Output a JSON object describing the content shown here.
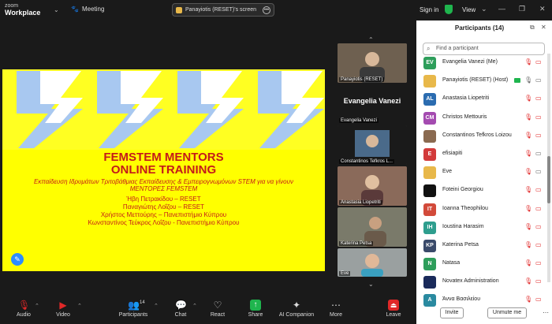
{
  "app": {
    "logo_small": "zoom",
    "logo_big": "Workplace",
    "meeting_label": "Meeting",
    "screen_share_label": "Panayiotis (RESET)'s screen",
    "signin": "Sign in",
    "view": "View"
  },
  "slide": {
    "title_line1": "FEMSTEM MENTORS",
    "title_line2": "ONLINE TRAINING",
    "subtitle": "Εκπαίδευση Ιδρυμάτων Τριτοβάθμιας Εκπαίδευσης & Εμπειρογνωμόνων STEM για να γίνουν ΜΕΝΤΟΡΕΣ FEMSTEM",
    "names": [
      "Ήβη Πετρακίδου – RESET",
      "Παναγιώτης Λοΐζου – RESET",
      "Χρήστος Μεττούρης – Πανεπιστήμιο Κύπρου",
      "Κωνσταντίνος Τεύκρος Λοΐζου - Πανεπιστήμιο Κύπρου"
    ],
    "colors": {
      "background": "#ffff00",
      "text": "#c41a1a",
      "chevron_light": "#a8c8f0",
      "chevron_white": "#ffffff"
    }
  },
  "strip": {
    "tiles": [
      {
        "label": "Panayiotis (RESET)"
      },
      {
        "name_big": "Evangelia Vanezi",
        "label": "Evangelia Vanezi"
      },
      {
        "label": "Constantinos Tefkros L..."
      },
      {
        "label": "Anastasia Liopetriti"
      },
      {
        "label": "Katerina Petsa"
      },
      {
        "label": "Eve"
      }
    ]
  },
  "toolbar": {
    "audio": "Audio",
    "video": "Video",
    "participants": "Participants",
    "participants_count": "14",
    "chat": "Chat",
    "react": "React",
    "share": "Share",
    "ai": "AI Companion",
    "more": "More",
    "leave": "Leave"
  },
  "panel": {
    "title": "Participants (14)",
    "search_placeholder": "Find a participant",
    "invite": "Invite",
    "unmute_me": "Unmute me",
    "participants": [
      {
        "initials": "EV",
        "color": "#2e9e5b",
        "name": "Evangelia Vanezi (Me)"
      },
      {
        "initials": "",
        "color": "#e8b84a",
        "name": "Panayiotis (RESET) (Host)"
      },
      {
        "initials": "AL",
        "color": "#2b6cb0",
        "name": "Anastasia Liopetriti"
      },
      {
        "initials": "CM",
        "color": "#a44bb0",
        "name": "Christos Mettouris"
      },
      {
        "initials": "",
        "color": "#8a6a50",
        "name": "Constantinos Tefkros Loizou"
      },
      {
        "initials": "E",
        "color": "#d23a3a",
        "name": "efisiapiti"
      },
      {
        "initials": "",
        "color": "#e8b84a",
        "name": "Eve"
      },
      {
        "initials": "",
        "color": "#111111",
        "name": "Foteini Georgiou"
      },
      {
        "initials": "IT",
        "color": "#d24a3a",
        "name": "Ioanna Theophilou"
      },
      {
        "initials": "IH",
        "color": "#2e9e8e",
        "name": "Ioustina Harasim"
      },
      {
        "initials": "KP",
        "color": "#3a4a6a",
        "name": "Katerina Petsa"
      },
      {
        "initials": "N",
        "color": "#2e9e5b",
        "name": "Natasa"
      },
      {
        "initials": "",
        "color": "#1a2a5a",
        "name": "Novatex Administration"
      },
      {
        "initials": "Α",
        "color": "#2a8aa0",
        "name": "Άννα Βασιλείου"
      }
    ]
  }
}
